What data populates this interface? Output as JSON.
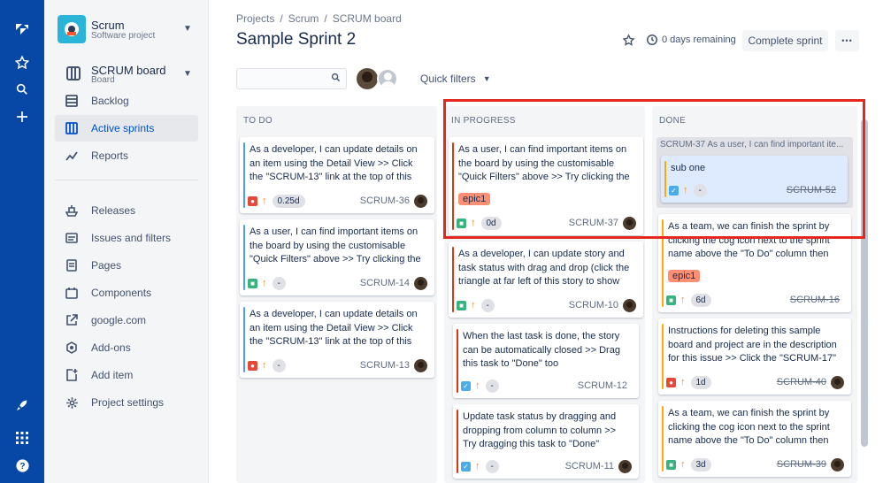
{
  "project": {
    "name": "Scrum",
    "type": "Software project"
  },
  "board": {
    "name": "SCRUM board",
    "type": "Board"
  },
  "nav_top": [
    {
      "label": "Backlog",
      "icon": "backlog-icon"
    },
    {
      "label": "Active sprints",
      "icon": "board-columns-icon",
      "active": true
    },
    {
      "label": "Reports",
      "icon": "reports-icon"
    }
  ],
  "nav_bottom": [
    {
      "label": "Releases",
      "icon": "ship-icon"
    },
    {
      "label": "Issues and filters",
      "icon": "issues-icon"
    },
    {
      "label": "Pages",
      "icon": "page-icon"
    },
    {
      "label": "Components",
      "icon": "components-icon"
    },
    {
      "label": "google.com",
      "icon": "external-link-icon"
    },
    {
      "label": "Add-ons",
      "icon": "addons-icon"
    },
    {
      "label": "Add item",
      "icon": "add-item-icon"
    },
    {
      "label": "Project settings",
      "icon": "gear-icon"
    }
  ],
  "breadcrumbs": [
    "Projects",
    "/",
    "Scrum",
    "/",
    "SCRUM board"
  ],
  "sprint_title": "Sample Sprint 2",
  "days_remaining": "0 days remaining",
  "complete_sprint": "Complete sprint",
  "more": "•••",
  "quick_filters": "Quick filters",
  "columns": [
    {
      "name": "TO DO"
    },
    {
      "name": "IN PROGRESS"
    },
    {
      "name": "DONE"
    }
  ],
  "todo": [
    {
      "text": "As a developer, I can update details on an item using the Detail View >> Click the \"SCRUM-13\" link at the top of this",
      "type": "bug",
      "est": "0.25d",
      "key": "SCRUM-36"
    },
    {
      "text": "As a user, I can find important items on the board by using the customisable \"Quick Filters\" above >> Try clicking the",
      "type": "story",
      "est": "-",
      "key": "SCRUM-14"
    },
    {
      "text": "As a developer, I can update details on an item using the Detail View >> Click the \"SCRUM-13\" link at the top of this",
      "type": "bug",
      "est": "-",
      "key": "SCRUM-13"
    }
  ],
  "inprogress": [
    {
      "text": "As a user, I can find important items on the board by using the customisable \"Quick Filters\" above >> Try clicking the",
      "epic": "epic1",
      "type": "story",
      "est": "0d",
      "key": "SCRUM-37"
    },
    {
      "text": "As a developer, I can update story and task status with drag and drop (click the triangle at far left of this story to show",
      "type": "story",
      "est": "-",
      "key": "SCRUM-10"
    },
    {
      "text": "When the last task is done, the story can be automatically closed >> Drag this task to \"Done\" too",
      "type": "task",
      "est": "-",
      "key": "SCRUM-12"
    },
    {
      "text": "Update task status by dragging and dropping from column to column >> Try dragging this task to \"Done\"",
      "type": "task",
      "est": "-",
      "key": "SCRUM-11"
    }
  ],
  "done": {
    "parent": "SCRUM-37 As a user, I can find important ite...",
    "sub": {
      "text": "sub one",
      "type": "task",
      "est": "-",
      "key": "SCRUM-52"
    },
    "cards": [
      {
        "text": "As a team, we can finish the sprint by clicking the cog icon next to the sprint name above the \"To Do\" column then",
        "epic": "epic1",
        "type": "story",
        "est": "6d",
        "key": "SCRUM-16"
      },
      {
        "text": "Instructions for deleting this sample board and project are in the description for this issue >> Click the \"SCRUM-17\"",
        "type": "bug",
        "est": "1d",
        "key": "SCRUM-40"
      },
      {
        "text": "As a team, we can finish the sprint by clicking the cog icon next to the sprint name above the \"To Do\" column then",
        "type": "story",
        "est": "3d",
        "key": "SCRUM-39"
      }
    ]
  },
  "colors": {
    "nav": "#0747a6",
    "story": "#36b37e",
    "bug": "#e5493a",
    "task": "#4bade8",
    "epic": "#ff8f73",
    "highlight": "#e5281f"
  }
}
